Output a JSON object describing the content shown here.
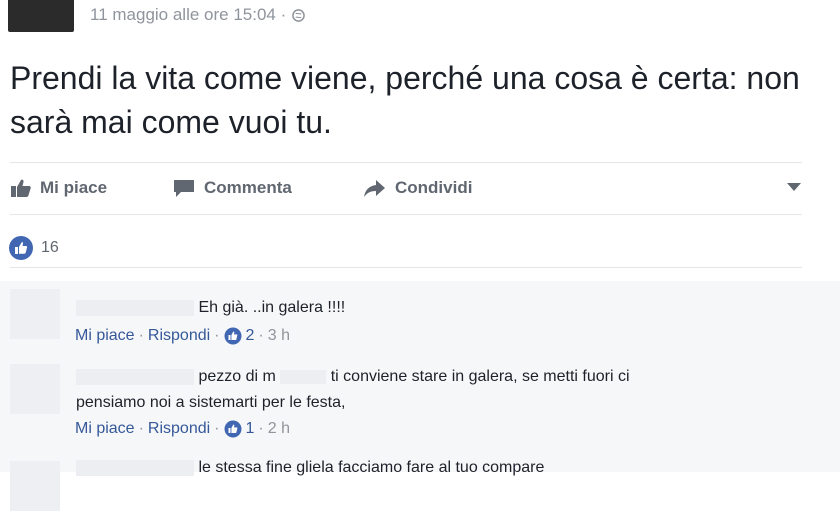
{
  "post": {
    "timestamp": "11 maggio alle ore 15:04 ·",
    "text": "Prendi la vita come viene, perché una cosa è certa: non sarà mai come vuoi tu."
  },
  "actions": {
    "like": "Mi piace",
    "comment": "Commenta",
    "share": "Condividi"
  },
  "reactions": {
    "count": "16"
  },
  "comments": [
    {
      "text": "Eh già. ..in galera !!!!",
      "like": "Mi piace",
      "reply": "Rispondi",
      "likes": "2",
      "time": "3 h"
    },
    {
      "text_a": "pezzo di m",
      "text_b": "ti conviene stare in galera, se metti fuori ci",
      "text_c": "pensiamo noi a sistemarti per le festa,",
      "like": "Mi piace",
      "reply": "Rispondi",
      "likes": "1",
      "time": "2 h"
    },
    {
      "text": "le stessa fine gliela facciamo fare al tuo compare"
    }
  ],
  "colors": {
    "accent": "#4267b2",
    "link": "#365899",
    "muted": "#90949c"
  }
}
